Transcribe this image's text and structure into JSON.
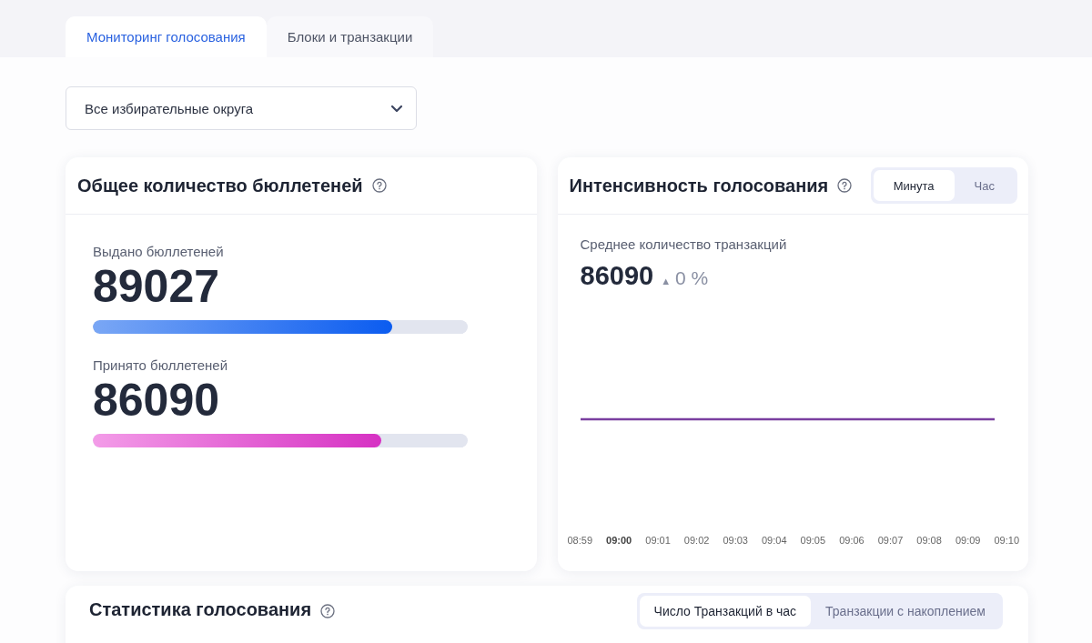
{
  "tabs": [
    {
      "label": "Мониторинг голосования",
      "selected": true
    },
    {
      "label": "Блоки и транзакции",
      "selected": false
    }
  ],
  "district_select": {
    "value": "Все избирательные округа"
  },
  "ballots_card": {
    "title": "Общее количество бюллетеней",
    "metrics": [
      {
        "label": "Выдано бюллетеней",
        "value": "89027",
        "level": 0.8,
        "kind": "blue"
      },
      {
        "label": "Принято бюллетеней",
        "value": "86090",
        "level": 0.77,
        "kind": "pink"
      }
    ]
  },
  "intensity_card": {
    "title": "Интенсивность голосования",
    "toggle": [
      {
        "label": "Минута",
        "selected": true
      },
      {
        "label": "Час",
        "selected": false
      }
    ],
    "metric_label": "Среднее количество транзакций",
    "metric_value": "86090",
    "trend_arrow": "▲",
    "change": "0 %",
    "x_labels": [
      {
        "label": "08:59",
        "current": false
      },
      {
        "label": "09:00",
        "current": true
      },
      {
        "label": "09:01",
        "current": false
      },
      {
        "label": "09:02",
        "current": false
      },
      {
        "label": "09:03",
        "current": false
      },
      {
        "label": "09:04",
        "current": false
      },
      {
        "label": "09:05",
        "current": false
      },
      {
        "label": "09:06",
        "current": false
      },
      {
        "label": "09:07",
        "current": false
      },
      {
        "label": "09:08",
        "current": false
      },
      {
        "label": "09:09",
        "current": false
      },
      {
        "label": "09:10",
        "current": false
      }
    ]
  },
  "stats_card": {
    "title": "Статистика голосования",
    "toggle": [
      {
        "label": "Число Транзакций в час",
        "selected": true
      },
      {
        "label": "Транзакции с накоплением",
        "selected": false
      }
    ]
  }
}
